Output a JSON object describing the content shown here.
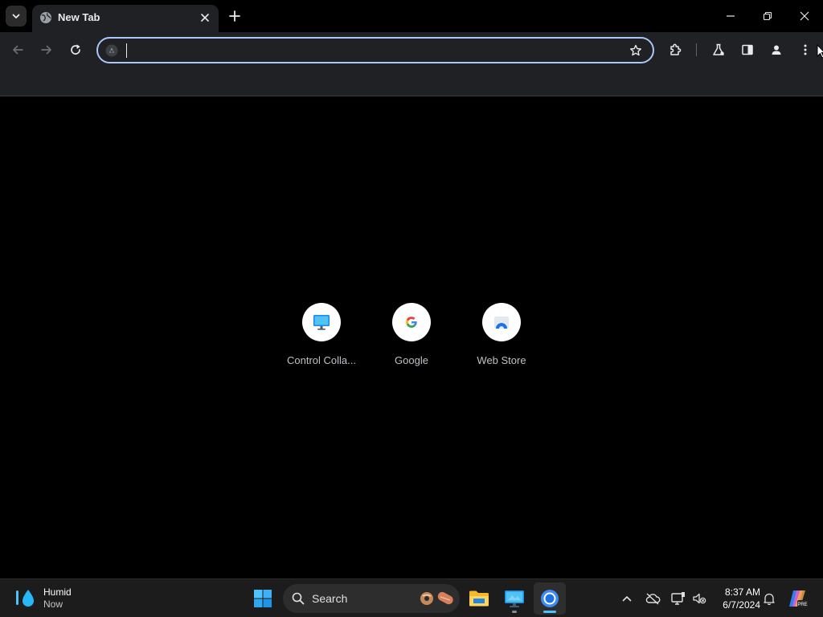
{
  "browser": {
    "tab": {
      "title": "New Tab"
    },
    "omnibox": {
      "value": "",
      "placeholder": ""
    }
  },
  "shortcuts": [
    {
      "label": "Control Colla...",
      "icon": "monitor-icon"
    },
    {
      "label": "Google",
      "icon": "google-g-icon"
    },
    {
      "label": "Web Store",
      "icon": "web-store-icon"
    }
  ],
  "taskbar": {
    "weather": {
      "condition": "Humid",
      "time": "Now",
      "icon": "water-drop-icon"
    },
    "search": {
      "label": "Search"
    },
    "clock": {
      "time": "8:37 AM",
      "date": "6/7/2024"
    }
  },
  "colors": {
    "accent": "#a8c7fa",
    "toolbar": "#202124",
    "taskbar": "#1c1c1c",
    "chrome_indicator": "#4cc2ff"
  }
}
